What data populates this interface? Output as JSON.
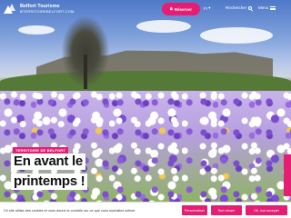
{
  "header": {
    "logo_title": "Belfort Tourisme",
    "logo_url": "BTERRITOIREBELFORT.COM",
    "reserve_label": "Réserver",
    "lang_label": "Fr",
    "search_label": "Rechercher",
    "menu_label": "Menu"
  },
  "hero": {
    "tag": "TERRITOIRE DE BELFORT",
    "headline_line1": "En avant le",
    "headline_line2": "printemps !"
  },
  "cookie": {
    "text": "Ce site utilise des cookies et vous donne le contrôle sur ce que vous souhaitez activer",
    "customize_label": "Personnaliser",
    "refuse_label": "Tout refuser",
    "accept_label": "OK, tout accepter"
  },
  "colors": {
    "accent": "#e61e73"
  },
  "icons": {
    "lock": "lock-icon",
    "search": "search-icon",
    "menu": "menu-icon",
    "chevron": "chevron-down-icon",
    "logo": "mountain-logo-icon"
  }
}
